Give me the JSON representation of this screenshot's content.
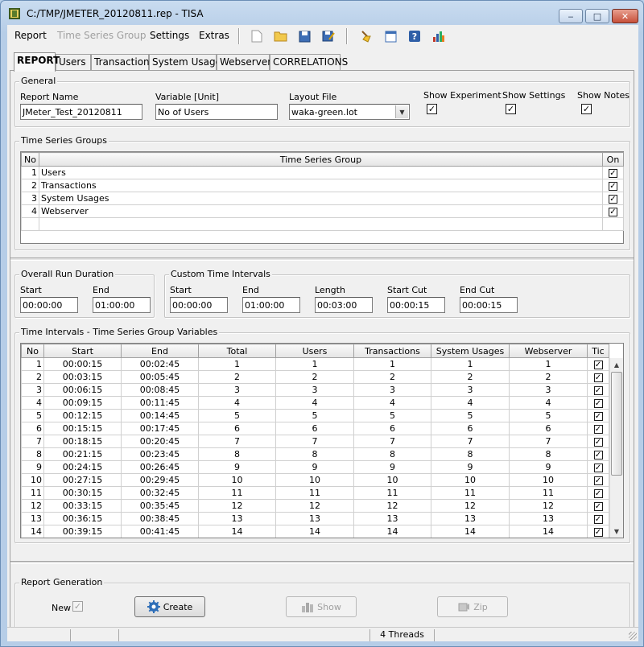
{
  "window": {
    "title": "C:/TMP/JMETER_20120811.rep - TISA"
  },
  "menu": {
    "report": "Report",
    "time_series_group": "Time Series Group",
    "settings": "Settings",
    "extras": "Extras"
  },
  "tabs": [
    "REPORT",
    "Users",
    "Transactions",
    "System Usages",
    "Webserver",
    "CORRELATIONS"
  ],
  "general": {
    "legend": "General",
    "report_name_label": "Report Name",
    "report_name": "JMeter_Test_20120811",
    "variable_label": "Variable [Unit]",
    "variable": "No of Users",
    "layout_label": "Layout File",
    "layout": "waka-green.lot",
    "show_experiment_label": "Show Experiment",
    "show_settings_label": "Show Settings",
    "show_notes_label": "Show Notes"
  },
  "tsg": {
    "legend": "Time Series Groups",
    "headers": {
      "no": "No",
      "group": "Time Series Group",
      "on": "On"
    },
    "rows": [
      {
        "no": "1",
        "name": "Users"
      },
      {
        "no": "2",
        "name": "Transactions"
      },
      {
        "no": "3",
        "name": "System Usages"
      },
      {
        "no": "4",
        "name": "Webserver"
      }
    ]
  },
  "overall": {
    "legend": "Overall Run Duration",
    "start_label": "Start",
    "start": "00:00:00",
    "end_label": "End",
    "end": "01:00:00"
  },
  "custom": {
    "legend": "Custom Time Intervals",
    "start_label": "Start",
    "start": "00:00:00",
    "end_label": "End",
    "end": "01:00:00",
    "length_label": "Length",
    "length": "00:03:00",
    "start_cut_label": "Start Cut",
    "start_cut": "00:00:15",
    "end_cut_label": "End Cut",
    "end_cut": "00:00:15"
  },
  "intervals": {
    "legend": "Time Intervals - Time Series Group Variables",
    "headers": [
      "No",
      "Start",
      "End",
      "Total",
      "Users",
      "Transactions",
      "System Usages",
      "Webserver",
      "Tic"
    ],
    "rows": [
      [
        "1",
        "00:00:15",
        "00:02:45",
        "1",
        "1",
        "1",
        "1",
        "1"
      ],
      [
        "2",
        "00:03:15",
        "00:05:45",
        "2",
        "2",
        "2",
        "2",
        "2"
      ],
      [
        "3",
        "00:06:15",
        "00:08:45",
        "3",
        "3",
        "3",
        "3",
        "3"
      ],
      [
        "4",
        "00:09:15",
        "00:11:45",
        "4",
        "4",
        "4",
        "4",
        "4"
      ],
      [
        "5",
        "00:12:15",
        "00:14:45",
        "5",
        "5",
        "5",
        "5",
        "5"
      ],
      [
        "6",
        "00:15:15",
        "00:17:45",
        "6",
        "6",
        "6",
        "6",
        "6"
      ],
      [
        "7",
        "00:18:15",
        "00:20:45",
        "7",
        "7",
        "7",
        "7",
        "7"
      ],
      [
        "8",
        "00:21:15",
        "00:23:45",
        "8",
        "8",
        "8",
        "8",
        "8"
      ],
      [
        "9",
        "00:24:15",
        "00:26:45",
        "9",
        "9",
        "9",
        "9",
        "9"
      ],
      [
        "10",
        "00:27:15",
        "00:29:45",
        "10",
        "10",
        "10",
        "10",
        "10"
      ],
      [
        "11",
        "00:30:15",
        "00:32:45",
        "11",
        "11",
        "11",
        "11",
        "11"
      ],
      [
        "12",
        "00:33:15",
        "00:35:45",
        "12",
        "12",
        "12",
        "12",
        "12"
      ],
      [
        "13",
        "00:36:15",
        "00:38:45",
        "13",
        "13",
        "13",
        "13",
        "13"
      ],
      [
        "14",
        "00:39:15",
        "00:41:45",
        "14",
        "14",
        "14",
        "14",
        "14"
      ]
    ]
  },
  "report_generation": {
    "legend": "Report Generation",
    "new_label": "New",
    "create": "Create",
    "show": "Show",
    "zip": "Zip"
  },
  "status": {
    "threads": "4 Threads"
  },
  "colors": {
    "accent": "#1e5fa8",
    "check": "#000000"
  }
}
